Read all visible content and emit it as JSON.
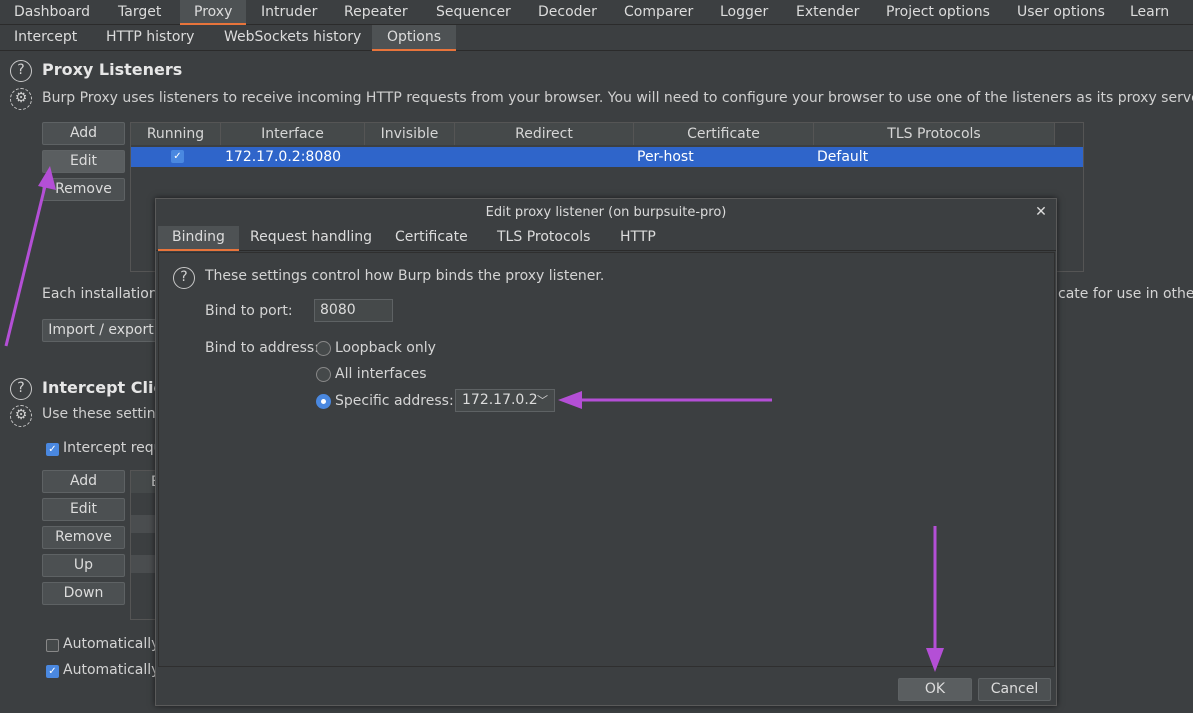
{
  "top_tabs": [
    "Dashboard",
    "Target",
    "Proxy",
    "Intruder",
    "Repeater",
    "Sequencer",
    "Decoder",
    "Comparer",
    "Logger",
    "Extender",
    "Project options",
    "User options",
    "Learn"
  ],
  "sub_tabs": [
    "Intercept",
    "HTTP history",
    "WebSockets history",
    "Options"
  ],
  "proxy_listeners": {
    "title": "Proxy Listeners",
    "description": "Burp Proxy uses listeners to receive incoming HTTP requests from your browser. You will need to configure your browser to use one of the listeners as its proxy server.",
    "buttons": [
      "Add",
      "Edit",
      "Remove"
    ],
    "columns": [
      "Running",
      "Interface",
      "Invisible",
      "Redirect",
      "Certificate",
      "TLS Protocols"
    ],
    "row": {
      "interface": "172.17.0.2:8080",
      "certificate": "Per-host",
      "tls": "Default"
    },
    "install_text": "Each installation o",
    "install_text_right": "cate for use in other",
    "import_export": "Import / export"
  },
  "intercept": {
    "title": "Intercept Clien",
    "description": "Use these setting",
    "checkbox_label": "Intercept requ",
    "buttons": [
      "Add",
      "Edit",
      "Remove",
      "Up",
      "Down"
    ],
    "table_header_partial": "E",
    "auto1": "Automatically",
    "auto2": "Automatically"
  },
  "dialog": {
    "title": "Edit proxy listener (on burpsuite-pro)",
    "close": "✕",
    "tabs": [
      "Binding",
      "Request handling",
      "Certificate",
      "TLS Protocols",
      "HTTP"
    ],
    "info": "These settings control how Burp binds the proxy listener.",
    "port_label": "Bind to port:",
    "port_value": "8080",
    "address_label": "Bind to address:",
    "option_loopback": "Loopback only",
    "option_all": "All interfaces",
    "option_specific": "Specific address:",
    "specific_value": "172.17.0.2",
    "ok": "OK",
    "cancel": "Cancel"
  },
  "colors": {
    "accent": "#e8743b",
    "annotation": "#b44fd6",
    "selection": "#2f65ca"
  }
}
